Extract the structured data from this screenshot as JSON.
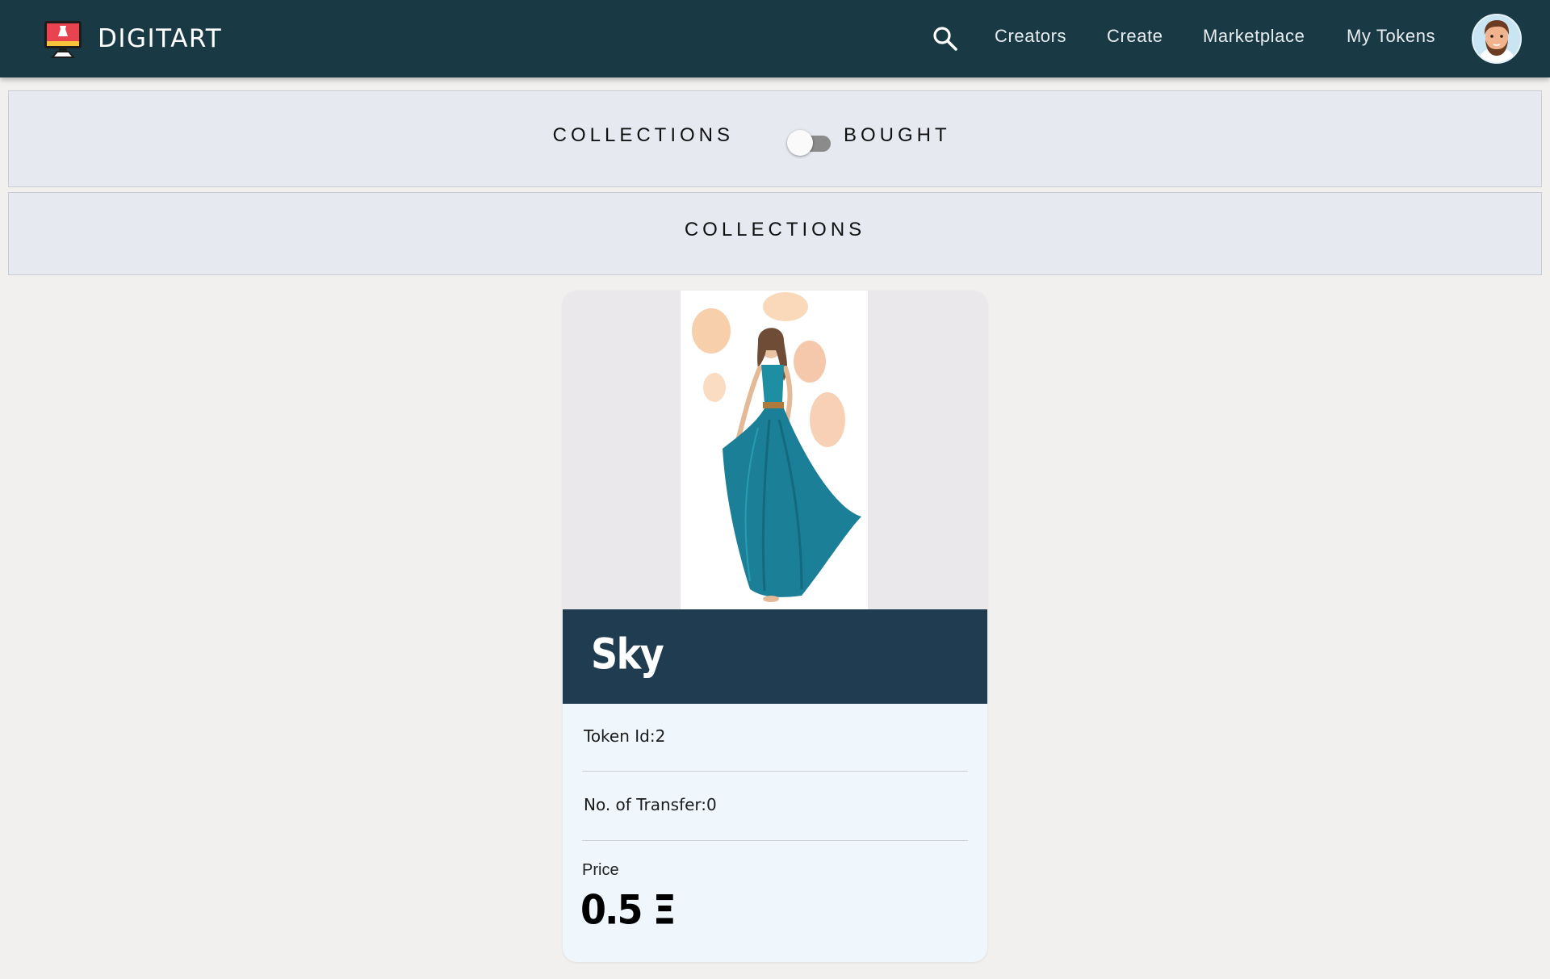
{
  "navbar": {
    "brand": "DIGITART",
    "links": [
      "Creators",
      "Create",
      "Marketplace",
      "My Tokens"
    ],
    "icons": {
      "logo": "monitor-dress-logo-icon",
      "search": "search-icon",
      "avatar": "user-avatar"
    }
  },
  "toggle": {
    "left_label": "COLLECTIONS",
    "right_label": "BOUGHT",
    "state": "off"
  },
  "section": {
    "title": "COLLECTIONS"
  },
  "card": {
    "title": "Sky",
    "token_id": "Token Id:2",
    "transfers": "No. of Transfer:0",
    "price_label": "Price",
    "price_value": "0.5 Ξ"
  },
  "colors": {
    "navbar": "#193a45",
    "card_header": "#1f3c50",
    "card_body": "#eff6fc",
    "page_bg": "#f1f0ee",
    "bar_bg": "#e6e9ef"
  }
}
